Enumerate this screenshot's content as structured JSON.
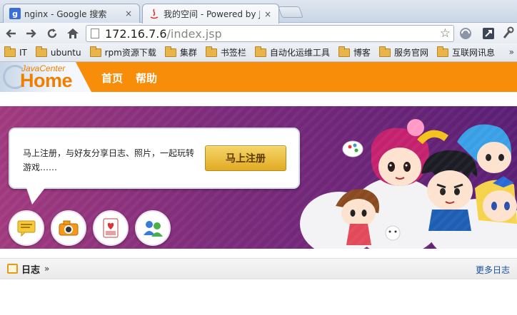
{
  "browser": {
    "tabs": [
      {
        "label": "nginx - Google 搜索",
        "favicon": "google-g-icon",
        "active": false
      },
      {
        "label": "我的空间 - Powered by J",
        "favicon": "java-icon",
        "active": true
      }
    ],
    "close_glyph": "×",
    "url_host": "172.16.7.6",
    "url_path": "/index.jsp",
    "bookmarks": [
      "IT",
      "ubuntu",
      "rpm资源下载",
      "集群",
      "书签栏",
      "自动化运维工具",
      "博客",
      "服务官网",
      "互联网讯息"
    ],
    "bookmarks_more": "»"
  },
  "site": {
    "logo_line1": "JavaCenter",
    "logo_line2": "Home",
    "nav": [
      "首页",
      "帮助"
    ],
    "brand_color": "#f88d0a"
  },
  "banner": {
    "message": "马上注册，与好友分享日志、照片，一起玩转游戏……",
    "signup_label": "马上注册",
    "feature_icons": [
      "blog-note-icon",
      "camera-icon",
      "poker-card-icon",
      "friends-icon"
    ]
  },
  "logbar": {
    "title": "日志",
    "arrow": "»",
    "more": "更多日志"
  }
}
